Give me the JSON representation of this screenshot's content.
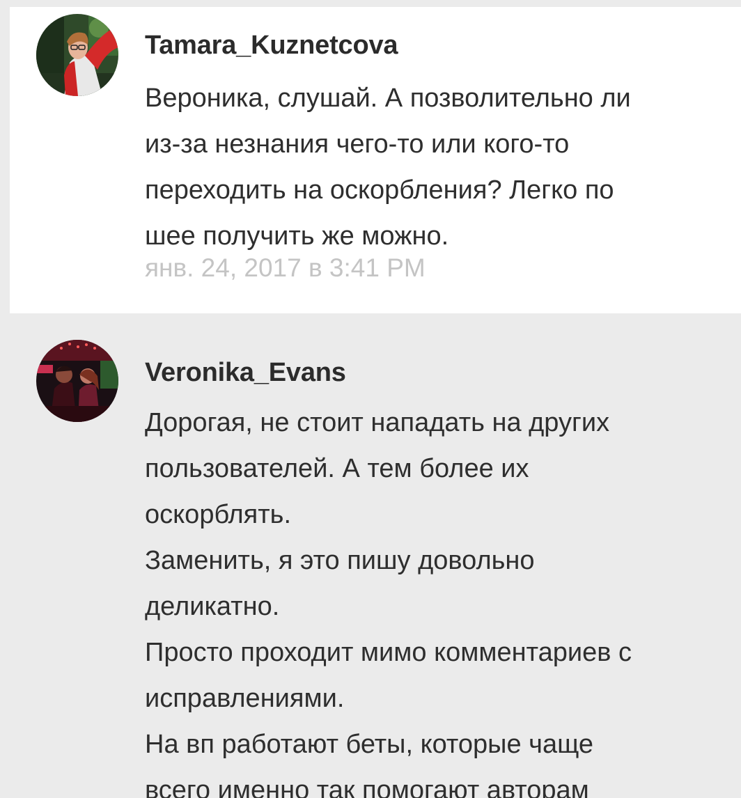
{
  "comments": [
    {
      "username": "Tamara_Kuznetcova",
      "lines": [
        "Вероника, слушай. А позволительно ли",
        "из-за незнания чего-то или кого-то",
        "переходить на оскорбления? Легко по",
        "шее получить же можно."
      ],
      "timestamp": "янв. 24, 2017 в 3:41 PM"
    },
    {
      "username": "Veronika_Evans",
      "lines": [
        "Дорогая, не стоит нападать на других",
        "пользователей. А тем более их",
        "оскорблять.",
        "Заменить, я это пишу довольно",
        "деликатно.",
        "Просто проходит мимо комментариев с",
        "исправлениями.",
        "На вп работают беты, которые чаще",
        "всего именно так помогают авторам"
      ]
    }
  ],
  "colors": {
    "comment_1_background": "#ffffff",
    "comment_2_background": "#ebebeb",
    "username_text": "#2b2b2b",
    "body_text": "#2e2e2e",
    "timestamp_text": "#c4c4c4"
  }
}
